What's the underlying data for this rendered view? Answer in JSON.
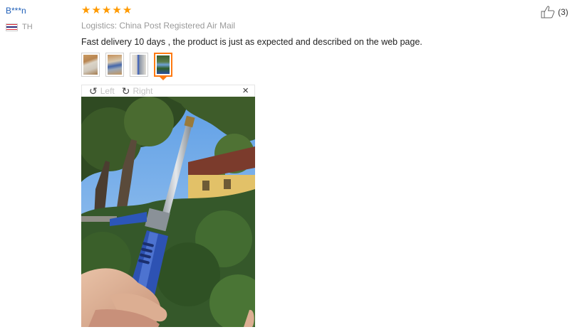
{
  "reviewer": {
    "name": "B***n",
    "country_code": "TH"
  },
  "review": {
    "rating": 5,
    "logistics": "Logistics: China Post Registered Air Mail",
    "text": "Fast delivery 10 days , the product is just as expected and described on the web page.",
    "thumbnails": [
      "photo-1",
      "photo-2",
      "photo-3",
      "photo-4"
    ],
    "selected_thumbnail": 4
  },
  "viewer": {
    "rotate_left": "Left",
    "rotate_right": "Right",
    "close": "×"
  },
  "helpful": {
    "count": "(3)"
  },
  "colors": {
    "star": "#ff9a00",
    "accent": "#ff7a12",
    "link": "#1f5fb8"
  },
  "icons": [
    "star-icon",
    "rotate-left-icon",
    "rotate-right-icon",
    "close-icon",
    "thumbs-up-icon",
    "thailand-flag-icon"
  ]
}
